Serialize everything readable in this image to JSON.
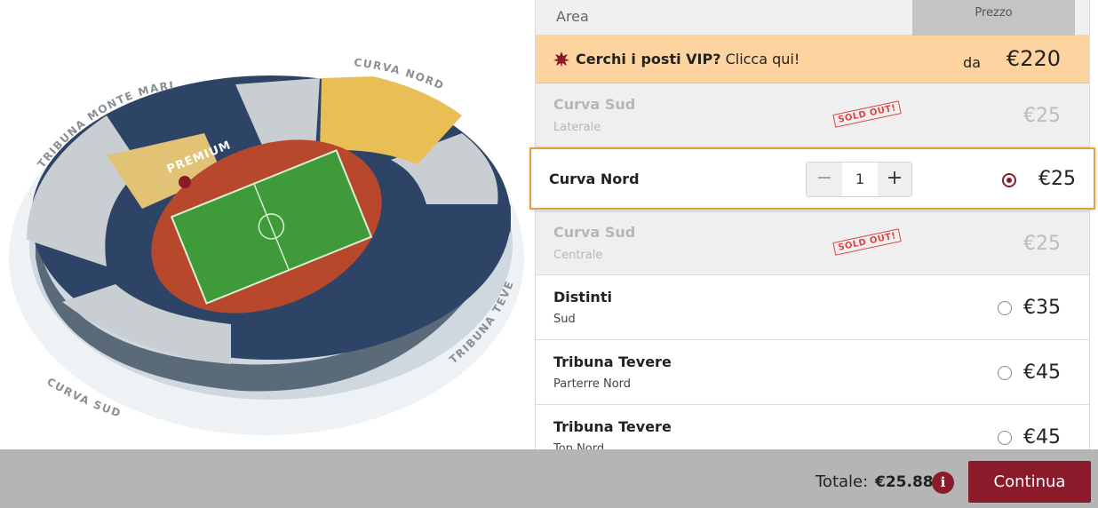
{
  "map": {
    "stand_labels": {
      "monte_mario": "TRIBUNA MONTE MARIO",
      "curva_nord": "CURVA NORD",
      "curva_sud": "CURVA SUD",
      "tevere": "TRIBUNA TEVERE",
      "premium": "PREMIUM"
    }
  },
  "table": {
    "header_area": "Area",
    "header_price": "Prezzo"
  },
  "vip": {
    "text_bold": "Cerchi i posti VIP?",
    "text_rest": " Clicca qui!",
    "from_label": "da",
    "price": "€220"
  },
  "rows": [
    {
      "name": "Curva Sud",
      "sub": "Laterale",
      "price": "€25",
      "sold_out": "SOLD OUT!"
    },
    {
      "name": "Curva Nord",
      "quantity": "1",
      "price": "€25",
      "minus": "−",
      "plus": "+"
    },
    {
      "name": "Curva Sud",
      "sub": "Centrale",
      "price": "€25",
      "sold_out": "SOLD OUT!"
    },
    {
      "name": "Distinti",
      "sub": "Sud",
      "price": "€35"
    },
    {
      "name": "Tribuna Tevere",
      "sub": "Parterre Nord",
      "price": "€45"
    },
    {
      "name": "Tribuna Tevere",
      "sub": "Top Nord",
      "price": "€45"
    }
  ],
  "footer": {
    "total_label": "Totale:",
    "total_value": "€25.88",
    "info_icon": "i",
    "continue_label": "Continua"
  },
  "colors": {
    "brand": "#8b1a2b",
    "vip_bg": "#fdd4a0",
    "highlight": "#e0a13c"
  }
}
